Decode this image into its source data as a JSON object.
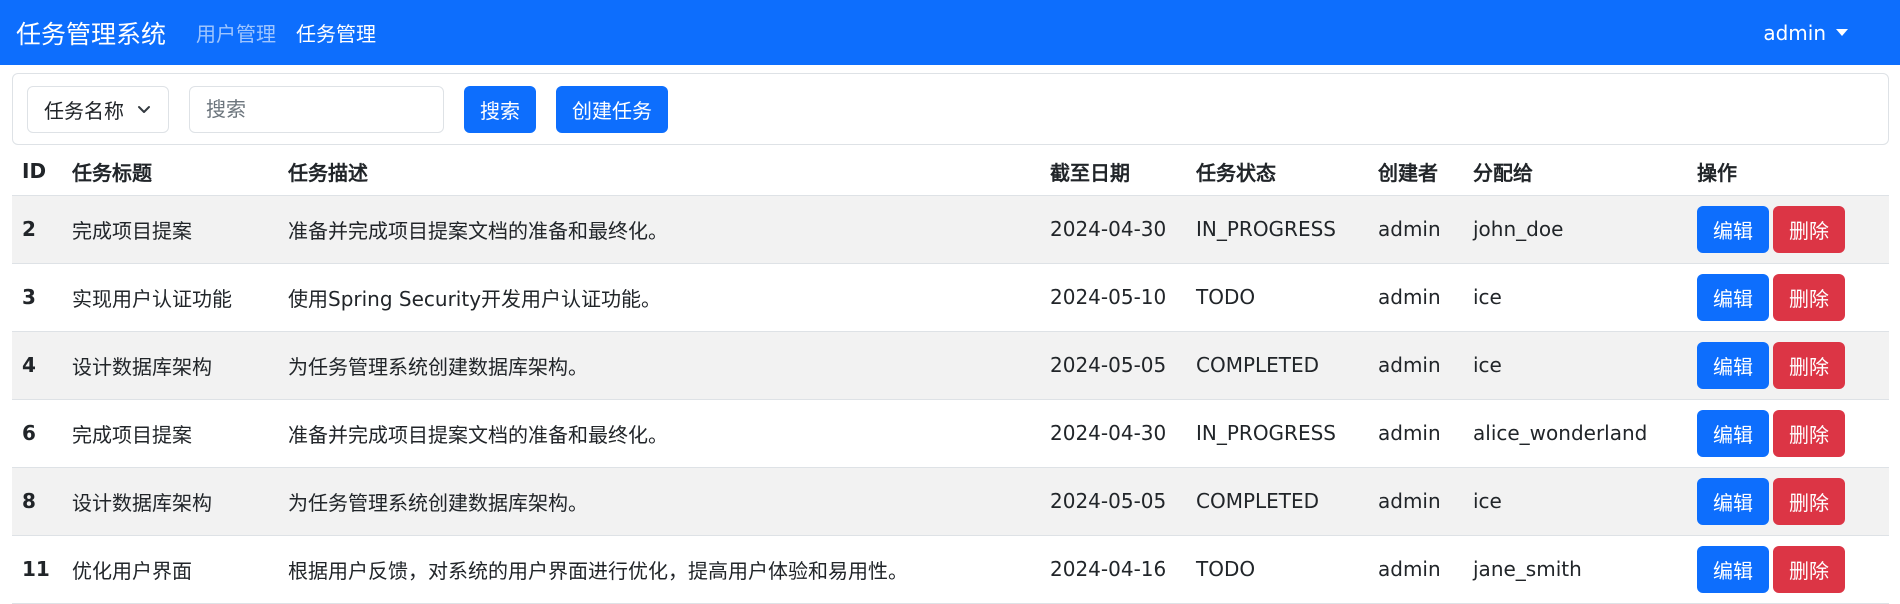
{
  "navbar": {
    "brand": "任务管理系统",
    "links": [
      "用户管理",
      "任务管理"
    ],
    "user": "admin"
  },
  "search": {
    "field_selected": "任务名称",
    "placeholder": "搜索",
    "value": "",
    "search_label": "搜索",
    "create_label": "创建任务"
  },
  "table": {
    "headers": [
      "ID",
      "任务标题",
      "任务描述",
      "截至日期",
      "任务状态",
      "创建者",
      "分配给",
      "操作"
    ],
    "rows": [
      {
        "id": "2",
        "title": "完成项目提案",
        "description": "准备并完成项目提案文档的准备和最终化。",
        "due": "2024-04-30",
        "status": "IN_PROGRESS",
        "creator": "admin",
        "assignee": "john_doe"
      },
      {
        "id": "3",
        "title": "实现用户认证功能",
        "description": "使用Spring Security开发用户认证功能。",
        "due": "2024-05-10",
        "status": "TODO",
        "creator": "admin",
        "assignee": "ice"
      },
      {
        "id": "4",
        "title": "设计数据库架构",
        "description": "为任务管理系统创建数据库架构。",
        "due": "2024-05-05",
        "status": "COMPLETED",
        "creator": "admin",
        "assignee": "ice"
      },
      {
        "id": "6",
        "title": "完成项目提案",
        "description": "准备并完成项目提案文档的准备和最终化。",
        "due": "2024-04-30",
        "status": "IN_PROGRESS",
        "creator": "admin",
        "assignee": "alice_wonderland"
      },
      {
        "id": "8",
        "title": "设计数据库架构",
        "description": "为任务管理系统创建数据库架构。",
        "due": "2024-05-05",
        "status": "COMPLETED",
        "creator": "admin",
        "assignee": "ice"
      },
      {
        "id": "11",
        "title": "优化用户界面",
        "description": "根据用户反馈，对系统的用户界面进行优化，提高用户体验和易用性。",
        "due": "2024-04-16",
        "status": "TODO",
        "creator": "admin",
        "assignee": "jane_smith"
      }
    ],
    "edit_label": "编辑",
    "delete_label": "删除"
  },
  "colors": {
    "primary": "#0d6efd",
    "danger": "#dc3545",
    "stripe": "#f2f2f2"
  },
  "icons": {
    "user_dropdown": "caret-down-icon",
    "select_dropdown": "chevron-down-icon"
  }
}
